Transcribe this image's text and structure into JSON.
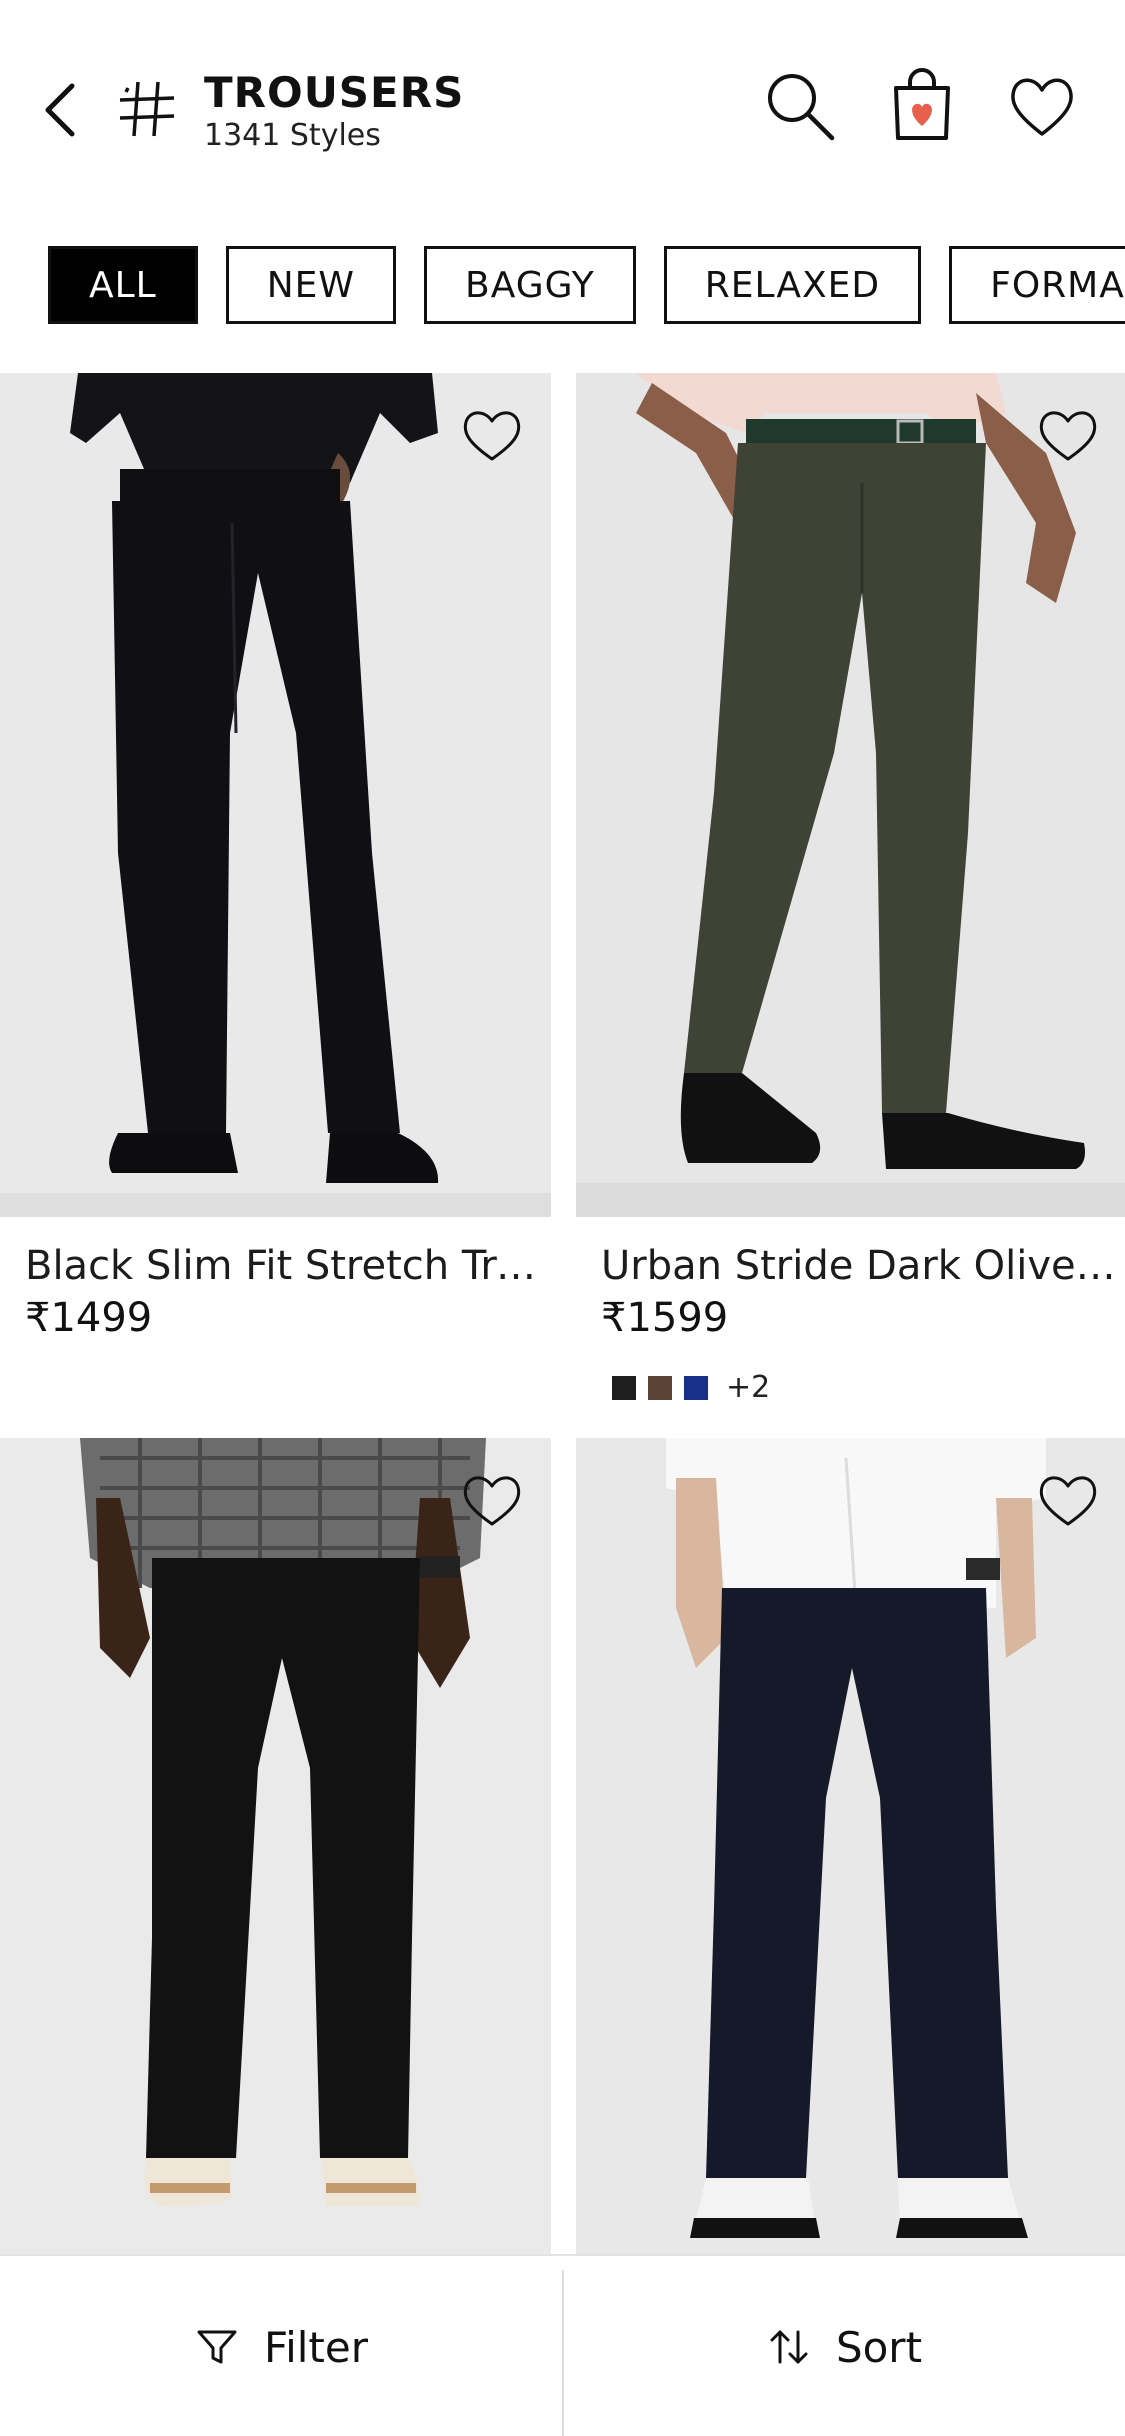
{
  "header": {
    "title": "TROUSERS",
    "subtitle": "1341 Styles"
  },
  "icons": {
    "back": "chevron-left-icon",
    "category": "hash-icon",
    "search": "search-icon",
    "bag": "shopping-bag-icon",
    "wishlist": "heart-icon"
  },
  "chips": [
    {
      "label": "ALL",
      "active": true
    },
    {
      "label": "NEW",
      "active": false
    },
    {
      "label": "BAGGY",
      "active": false
    },
    {
      "label": "RELAXED",
      "active": false
    },
    {
      "label": "FORMAL",
      "active": false
    }
  ],
  "products": [
    {
      "name": "Black Slim Fit Stretch Tro...",
      "price": "₹1499"
    },
    {
      "name": "Urban Stride Dark Olive ...",
      "price": "₹1599",
      "swatches": [
        "#1e1e1e",
        "#5a4236",
        "#17318a"
      ],
      "more_colors": "+2"
    },
    {
      "name": "",
      "price": ""
    },
    {
      "name": "",
      "price": ""
    }
  ],
  "bottom_bar": {
    "filter_label": "Filter",
    "sort_label": "Sort"
  },
  "colors": {
    "accent": "#e8604c",
    "active_chip": "#000000"
  }
}
